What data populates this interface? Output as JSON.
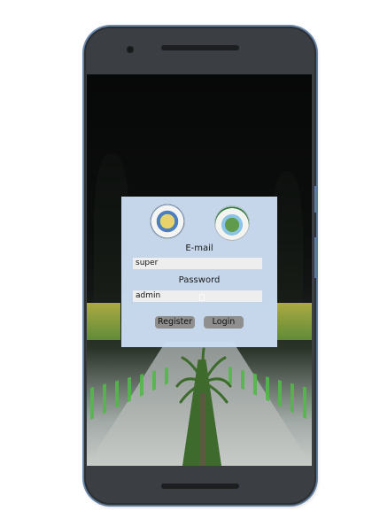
{
  "login": {
    "email_label": "E-mail",
    "email_value": "super",
    "password_label": "Password",
    "password_value": "admin",
    "register_label": "Register",
    "login_label": "Login"
  },
  "icons": {
    "left_seal": "city-seal-icon",
    "right_seal": "municipal-seal-icon"
  },
  "colors": {
    "panel": "#cbddf2",
    "field": "#eeeeee",
    "button": "#8f8f8f",
    "phone_body": "#3b3e42",
    "phone_rim": "#6f8fb5"
  }
}
